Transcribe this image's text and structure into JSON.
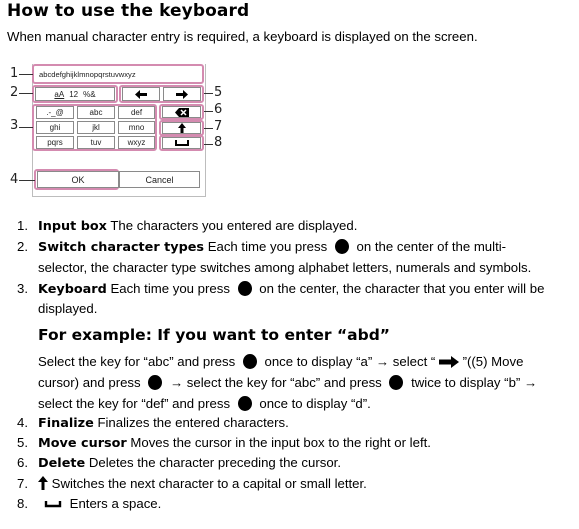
{
  "title": "How to use the keyboard",
  "intro": "When manual character entry is required, a keyboard is displayed on the screen.",
  "figure": {
    "callouts": [
      "1",
      "2",
      "3",
      "4",
      "5",
      "6",
      "7",
      "8"
    ],
    "input_text": "abcdefghijklmnopqrstuvwxyz",
    "switch_key": {
      "part1": "aA",
      "part2": "12",
      "part3": "%&"
    },
    "arrow_left": "🡄",
    "arrow_right": "🡆",
    "keys": [
      ".-_@",
      "abc",
      "def",
      "ghi",
      "jkl",
      "mno",
      "pqrs",
      "tuv",
      "wxyz"
    ],
    "ok_label": "OK",
    "cancel_label": "Cancel",
    "highlight_color": "#d48bb0"
  },
  "items": [
    {
      "num": "1.",
      "term": "Input box",
      "text": " The characters you entered are displayed."
    },
    {
      "num": "2.",
      "term": "Switch character types",
      "text_a": " Each time you press ",
      "text_b": " on the center of the multi-",
      "text_c": "selector, the character type switches among alphabet letters, numerals and symbols."
    },
    {
      "num": "3.",
      "term": "Keyboard",
      "text_a": " Each time you press ",
      "text_b": " on the center, the character that you enter will be",
      "text_c": "displayed."
    },
    {
      "num": "4.",
      "term": "Finalize",
      "text": " Finalizes the entered characters."
    },
    {
      "num": "5.",
      "term": "Move cursor",
      "text": " Moves the cursor in the input box to the right or left."
    },
    {
      "num": "6.",
      "term": "Delete",
      "text": " Deletes the character preceding the cursor."
    },
    {
      "num": "7.",
      "text": " Switches the next character to a capital or small letter."
    },
    {
      "num": "8.",
      "text": " Enters a space."
    }
  ],
  "example": {
    "heading": "For example: If you want to enter “abd”",
    "l1a": "Select the key for “abc” and press ",
    "l1b": " once to display “a” → select “ ",
    "l1c": " ”((5) Move",
    "l2a": "cursor) and press ",
    "l2b": " → select the key for “abc” and press ",
    "l2c": " twice to display “b” →",
    "l3a": "select the key for “def” and press ",
    "l3b": " once to display “d”."
  }
}
